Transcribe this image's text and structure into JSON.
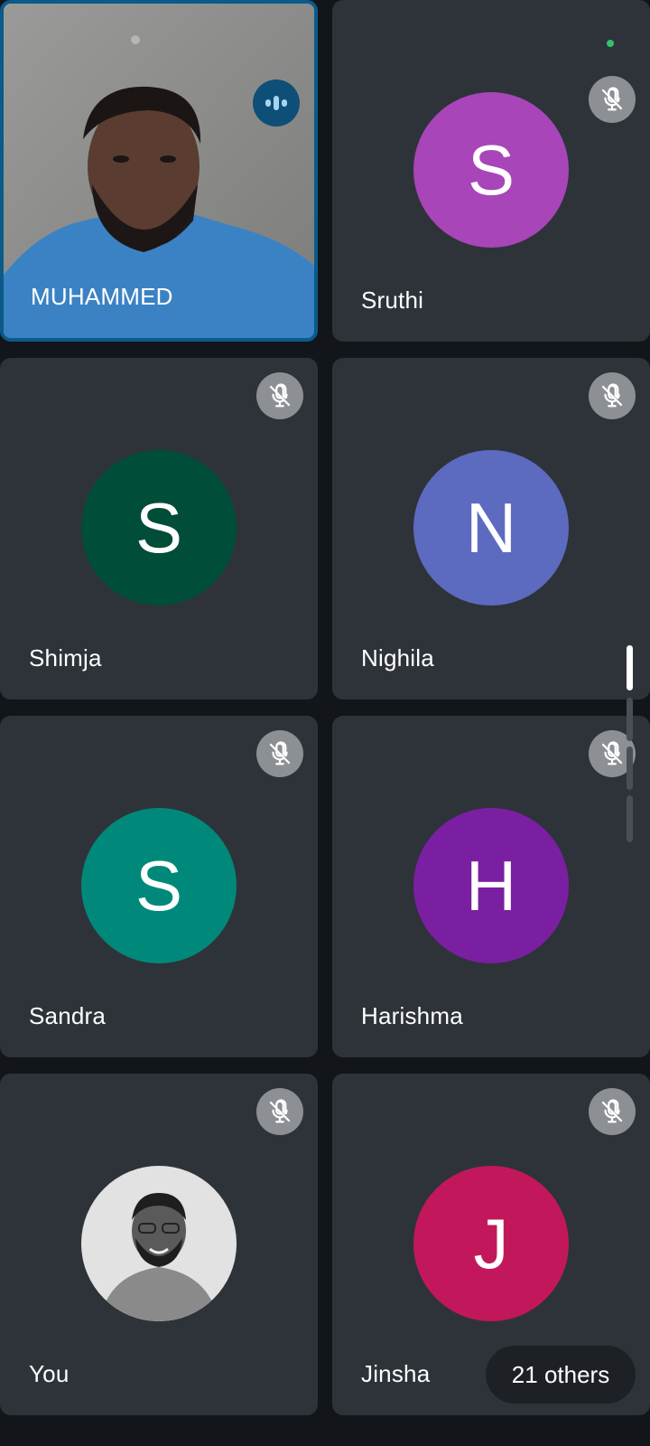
{
  "participants": [
    {
      "name": "MUHAMMED",
      "type": "video",
      "speaking": true
    },
    {
      "name": "Sruthi",
      "initial": "S",
      "color": "#a845b8",
      "muted": true
    },
    {
      "name": "Shimja",
      "initial": "S",
      "color": "#004d3a",
      "muted": true
    },
    {
      "name": "Nighila",
      "initial": "N",
      "color": "#5c6bc0",
      "muted": true
    },
    {
      "name": "Sandra",
      "initial": "S",
      "color": "#00897b",
      "muted": true
    },
    {
      "name": "Harishma",
      "initial": "H",
      "color": "#7b1fa2",
      "muted": true
    },
    {
      "name": "You",
      "type": "photo",
      "muted": true
    },
    {
      "name": "Jinsha",
      "initial": "J",
      "color": "#c2185b",
      "muted": true
    }
  ],
  "others_label": "21 others",
  "icons": {
    "muted": "mic-off-icon",
    "speaking": "audio-level-icon",
    "active": "green-dot"
  },
  "colors": {
    "background": "#121519",
    "tile": "#2e333a",
    "speaking_border": "#0a5b8a"
  }
}
